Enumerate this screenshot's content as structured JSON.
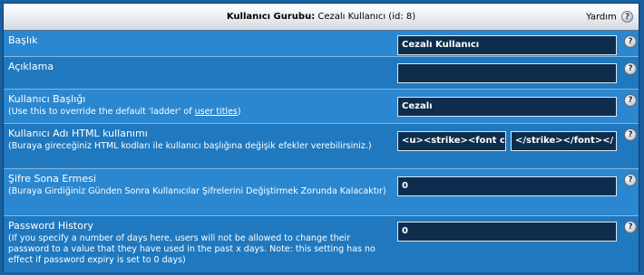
{
  "header": {
    "title_label": "Kullanıcı Gurubu:",
    "title_value": "Cezalı Kullanıcı (id: 8)",
    "help_label": "Yardım"
  },
  "rows": [
    {
      "title": "Başlık",
      "value": "Cezalı Kullanıcı"
    },
    {
      "title": "Açıklama",
      "value": ""
    },
    {
      "title": "Kullanıcı Başlığı",
      "desc_prefix": "(Use this to override the default 'ladder' of ",
      "desc_link": "user titles",
      "desc_suffix": ")",
      "value": "Cezalı"
    },
    {
      "title": "Kullanıcı Adı HTML kullanımı",
      "desc": "(Buraya gireceğiniz HTML kodları ile kullanıcı başlığına değişik efekler verebilirsiniz.)",
      "value_open": "<u><strike><font c",
      "value_close": "</strike></font></"
    },
    {
      "title": "Şifre Sona Ermesi",
      "desc": "(Buraya Girdiğiniz Günden Sonra Kullanıcılar Şifrelerini Değiştirmek Zorunda Kalacaktır)",
      "value": "0"
    },
    {
      "title": "Password History",
      "desc": "(If you specify a number of days here, users will not be allowed to change their password to a value that they have used in the past x days. Note: this setting has no effect if password expiry is set to 0 days)",
      "value": "0"
    }
  ],
  "help_icon_glyph": "?"
}
